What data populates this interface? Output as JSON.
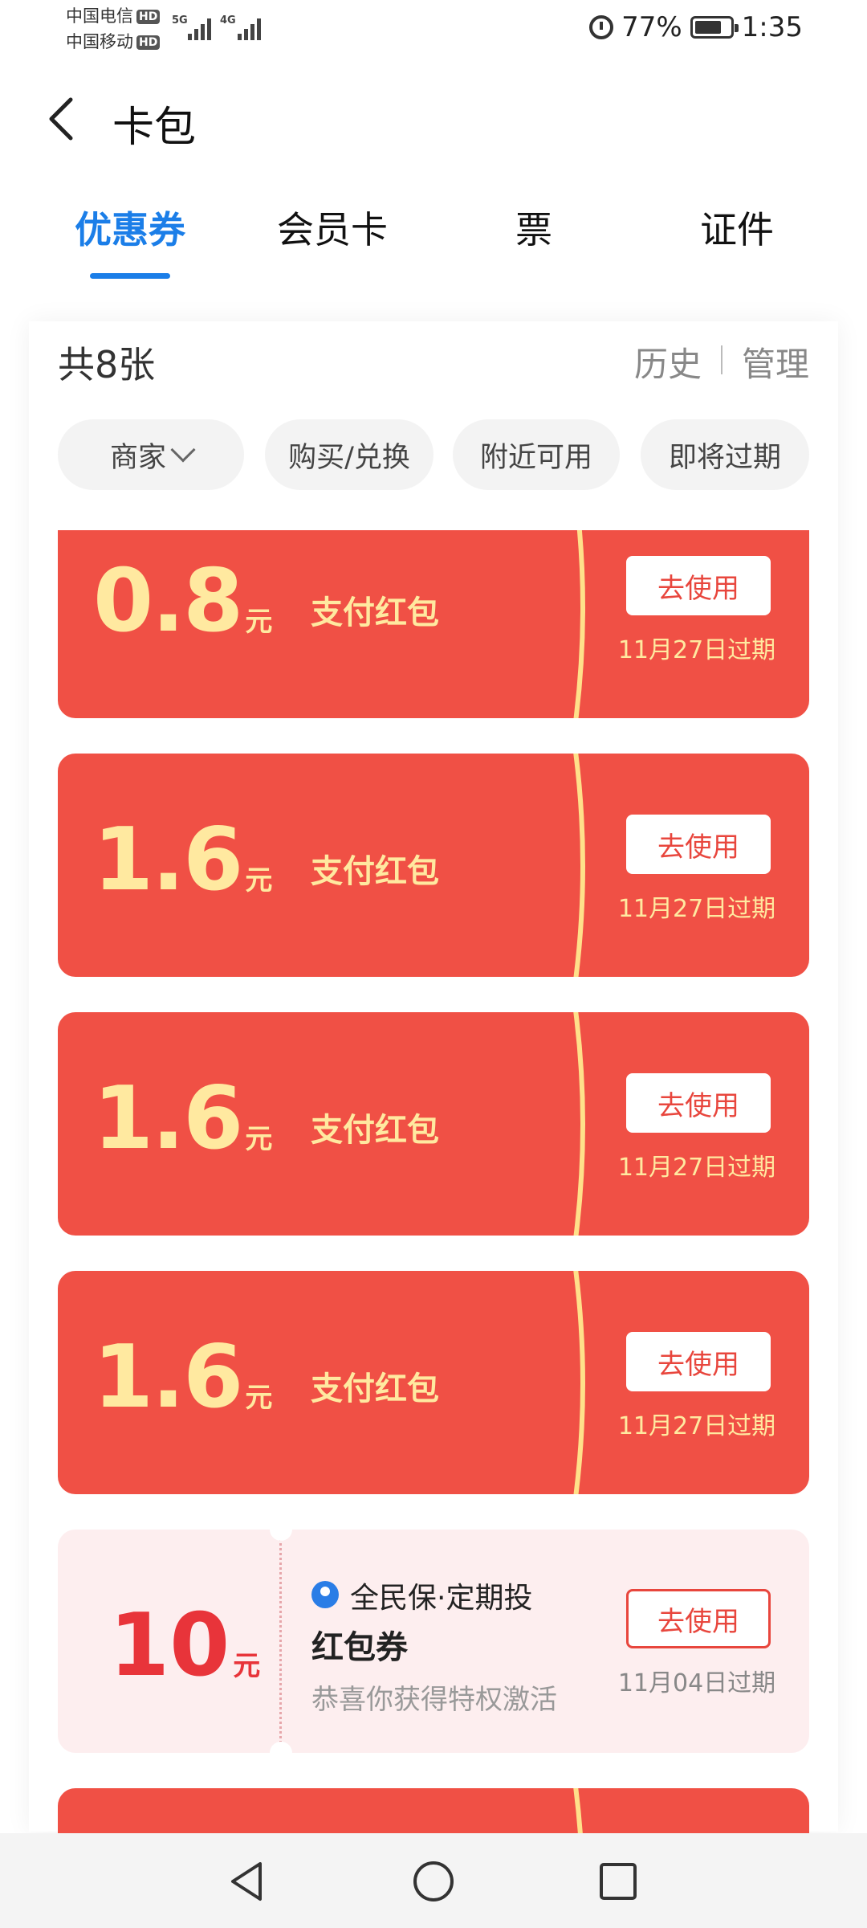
{
  "status_bar": {
    "carrier1": "中国电信",
    "carrier2": "中国移动",
    "hd": "HD",
    "net1": "5G",
    "net2": "4G",
    "battery_pct": "77%",
    "battery_level": 0.77,
    "time": "1:35"
  },
  "header": {
    "title": "卡包"
  },
  "tabs": [
    {
      "label": "优惠券",
      "active": true
    },
    {
      "label": "会员卡",
      "active": false
    },
    {
      "label": "票",
      "active": false
    },
    {
      "label": "证件",
      "active": false
    }
  ],
  "summary": {
    "count": "共8张",
    "history": "历史",
    "manage": "管理"
  },
  "filters": [
    {
      "label": "商家"
    },
    {
      "label": "购买/兑换"
    },
    {
      "label": "附近可用"
    },
    {
      "label": "即将过期"
    }
  ],
  "coupons": [
    {
      "amount": "0.8",
      "unit": "元",
      "name": "支付红包",
      "button": "去使用",
      "expiry": "11月27日过期"
    },
    {
      "amount": "1.6",
      "unit": "元",
      "name": "支付红包",
      "button": "去使用",
      "expiry": "11月27日过期"
    },
    {
      "amount": "1.6",
      "unit": "元",
      "name": "支付红包",
      "button": "去使用",
      "expiry": "11月27日过期"
    },
    {
      "amount": "1.6",
      "unit": "元",
      "name": "支付红包",
      "button": "去使用",
      "expiry": "11月27日过期"
    }
  ],
  "coupon_special": {
    "amount": "10",
    "unit": "元",
    "brand": "全民保·定期投",
    "title": "红包券",
    "desc": "恭喜你获得特权激活",
    "button": "去使用",
    "expiry": "11月04日过期"
  },
  "colors": {
    "accent": "#1b7ee8",
    "coupon_red": "#f05045",
    "coupon_text": "#ffe9a0",
    "light_coupon_bg": "#fdeeef"
  },
  "nav": {
    "back": "back-triangle-icon",
    "home": "home-circle-icon",
    "recent": "recent-square-icon"
  }
}
